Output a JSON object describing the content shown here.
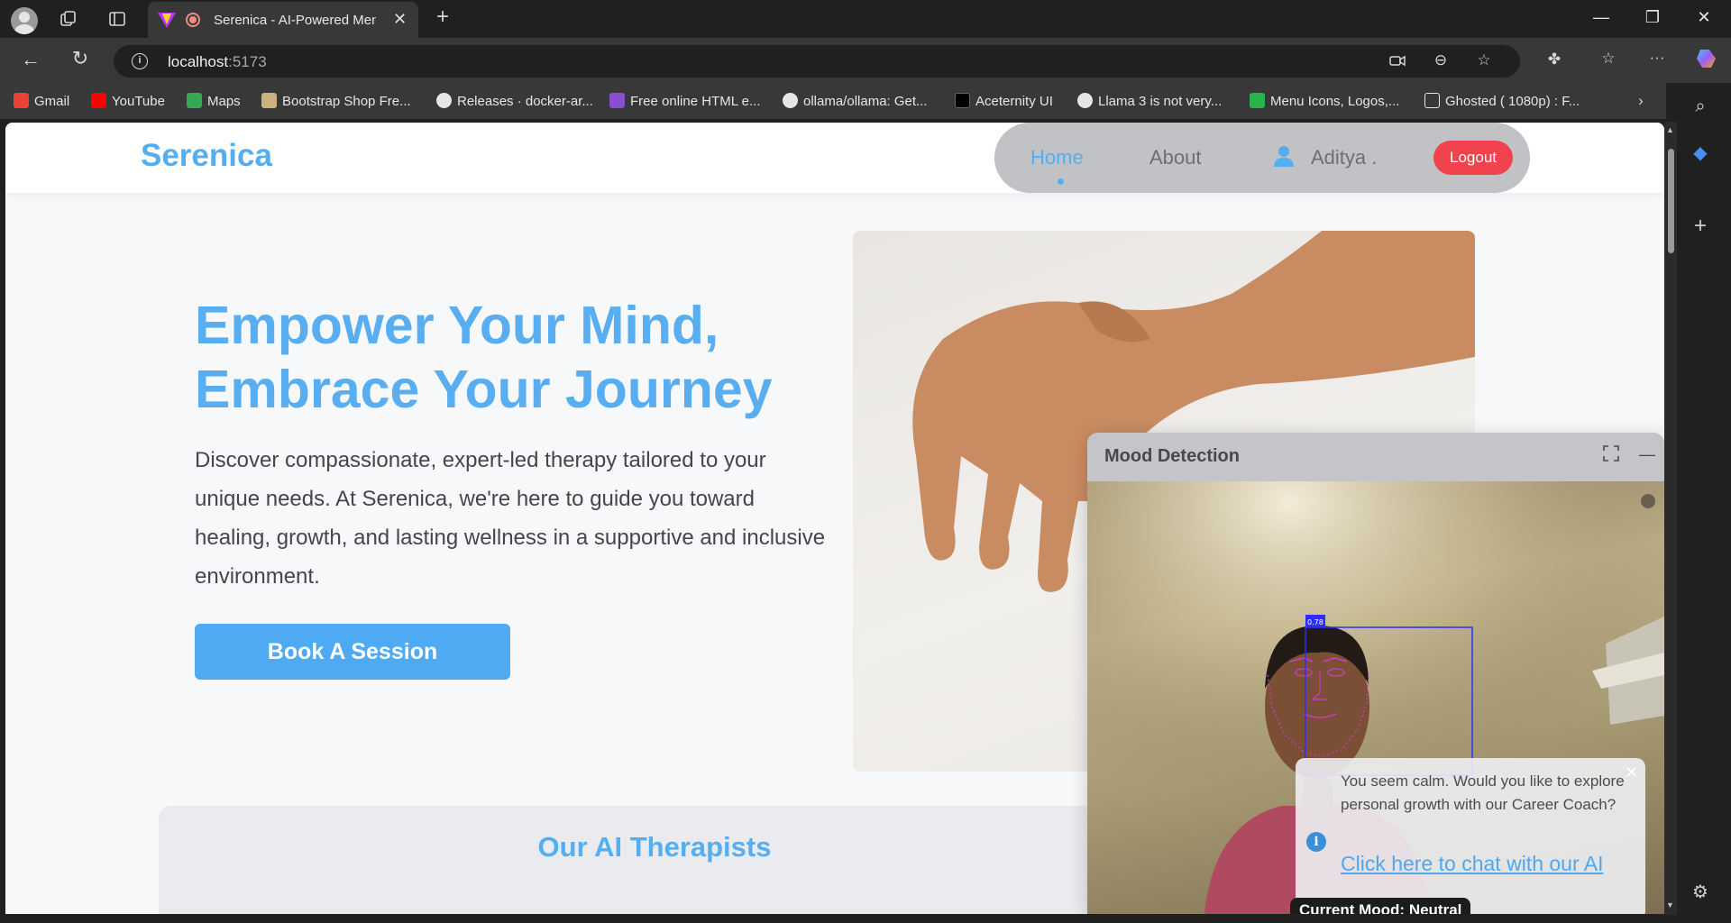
{
  "browser": {
    "tab_title": "Serenica - AI-Powered Menta",
    "url_host": "localhost",
    "url_port": ":5173",
    "bookmarks": [
      {
        "label": "Gmail",
        "icon": "gmail-icon",
        "color": "#ea4335"
      },
      {
        "label": "YouTube",
        "icon": "youtube-icon",
        "color": "#ff0000"
      },
      {
        "label": "Maps",
        "icon": "maps-icon",
        "color": "#34a853"
      },
      {
        "label": "Bootstrap Shop Fre...",
        "icon": "bootstrap-icon",
        "color": "#c9b37a"
      },
      {
        "label": "Releases · docker-ar...",
        "icon": "github-icon",
        "color": "#e6e6e6"
      },
      {
        "label": "Free online HTML e...",
        "icon": "html-editor-icon",
        "color": "#8a4fd0"
      },
      {
        "label": "ollama/ollama: Get...",
        "icon": "github-icon",
        "color": "#e6e6e6"
      },
      {
        "label": "Aceternity UI",
        "icon": "aceternity-icon",
        "color": "#000000"
      },
      {
        "label": "Llama 3 is not very...",
        "icon": "reddit-icon",
        "color": "#e6e6e6"
      },
      {
        "label": "Menu Icons, Logos,...",
        "icon": "icons-site-icon",
        "color": "#2ab24b"
      },
      {
        "label": "Ghosted ( 1080p) : F...",
        "icon": "archive-icon",
        "color": "#e6e6e6"
      }
    ]
  },
  "site": {
    "brand": "Serenica",
    "nav": {
      "home": "Home",
      "about": "About",
      "user": "Aditya .",
      "logout": "Logout"
    },
    "accent": "#55aef0",
    "hero": {
      "title": "Empower Your Mind, Embrace Your Journey",
      "text": "Discover compassionate, expert-led therapy tailored to your unique needs. At Serenica, we're here to guide you toward healing, growth, and lasting wellness in a supportive and inclusive environment.",
      "cta": "Book A Session"
    },
    "section_title": "Our AI Therapists"
  },
  "mood_widget": {
    "title": "Mood Detection",
    "detection_score": "0.78",
    "toast_message": "You seem calm. Would you like to explore personal growth with our Career Coach?",
    "toast_link": "Click here to chat with our AI",
    "current_mood": "Current Mood: Neutral"
  }
}
